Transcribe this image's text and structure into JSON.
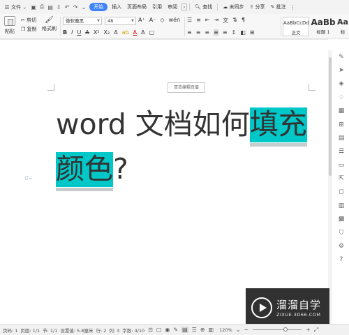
{
  "menubar": {
    "menu_icon": "hamburger-icon",
    "file_label": "文件",
    "start_tab": "开始",
    "tabs": [
      "插入",
      "页面布局",
      "引用",
      "审阅"
    ],
    "search_label": "查找",
    "sync_label": "未同步",
    "share_label": "分享",
    "comment_label": "批注"
  },
  "ribbon": {
    "paste_label": "粘贴",
    "cut_label": "剪切",
    "copy_label": "复制",
    "format_painter_label": "格式刷",
    "font_name": "微软雅黑",
    "font_size": "48",
    "styles": [
      {
        "sample": "AaBbCcDd",
        "name": "正文"
      },
      {
        "sample": "AaBb",
        "name": "标题 1"
      },
      {
        "sample": "Aa",
        "name": "标"
      }
    ]
  },
  "document": {
    "header_tip": "双击编辑页眉",
    "line1_plain": "word 文档如何",
    "line1_highlight": "填充",
    "line2_highlight": "颜色",
    "line2_plain": "?"
  },
  "highlight_color": "#00c8c8",
  "statusbar": {
    "page": "页码: 1",
    "pages": "页面: 1/1",
    "section": "节: 1/1",
    "position": "设置值: 5.8厘米",
    "row": "行: 2",
    "column": "列: 3",
    "words": "字数: 4/10",
    "zoom": "120%",
    "zoom_value": 0.67
  },
  "watermark": {
    "name": "溜溜自学",
    "url": "ZIXUE.3D66.COM"
  }
}
